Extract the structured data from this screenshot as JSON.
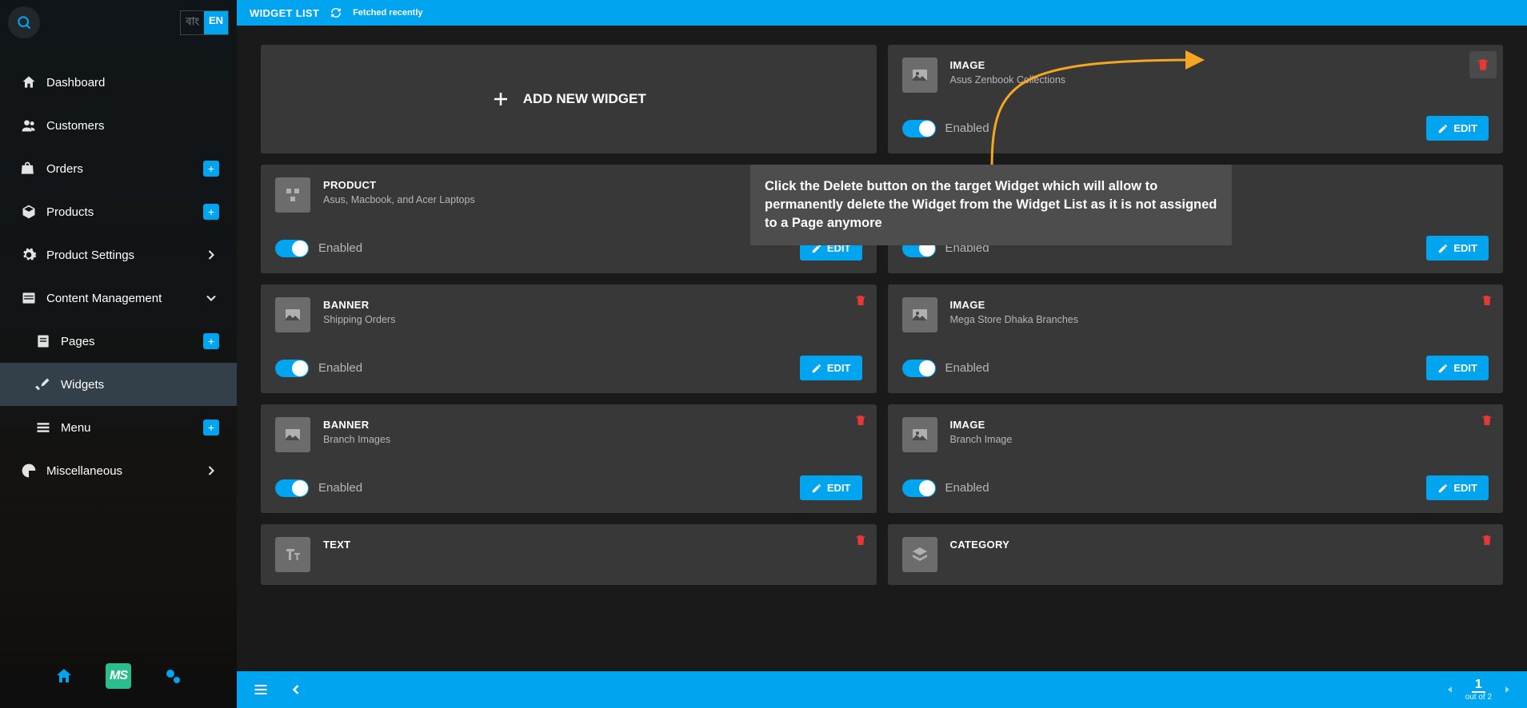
{
  "sidebar": {
    "lang_bn": "বাং",
    "lang_en": "EN",
    "items": {
      "dashboard": {
        "label": "Dashboard"
      },
      "customers": {
        "label": "Customers"
      },
      "orders": {
        "label": "Orders"
      },
      "products": {
        "label": "Products"
      },
      "prodset": {
        "label": "Product Settings"
      },
      "content": {
        "label": "Content Management"
      },
      "pages": {
        "label": "Pages"
      },
      "widgets": {
        "label": "Widgets"
      },
      "menu": {
        "label": "Menu"
      },
      "misc": {
        "label": "Miscellaneous"
      }
    }
  },
  "topbar": {
    "title": "WIDGET LIST",
    "fetched": "Fetched recently"
  },
  "add_widget": {
    "label": "ADD NEW WIDGET"
  },
  "cards": [
    {
      "type": "IMAGE",
      "subtitle": "Asus Zenbook Collections"
    },
    {
      "type": "PRODUCT",
      "subtitle": "Asus, Macbook, and Acer Laptops"
    },
    {
      "type": "",
      "subtitle": ""
    },
    {
      "type": "BANNER",
      "subtitle": "Shipping Orders"
    },
    {
      "type": "IMAGE",
      "subtitle": "Mega Store Dhaka Branches"
    },
    {
      "type": "BANNER",
      "subtitle": "Branch Images"
    },
    {
      "type": "IMAGE",
      "subtitle": "Branch Image"
    },
    {
      "type": "TEXT",
      "subtitle": ""
    },
    {
      "type": "CATEGORY",
      "subtitle": ""
    }
  ],
  "common": {
    "enabled": "Enabled",
    "edit": "EDIT"
  },
  "tooltip": "Click the Delete button on the target Widget which will allow to permanently delete the Widget from the Widget List as it is not assigned to a Page anymore",
  "pagination": {
    "page": "1",
    "outof": "out of 2"
  }
}
